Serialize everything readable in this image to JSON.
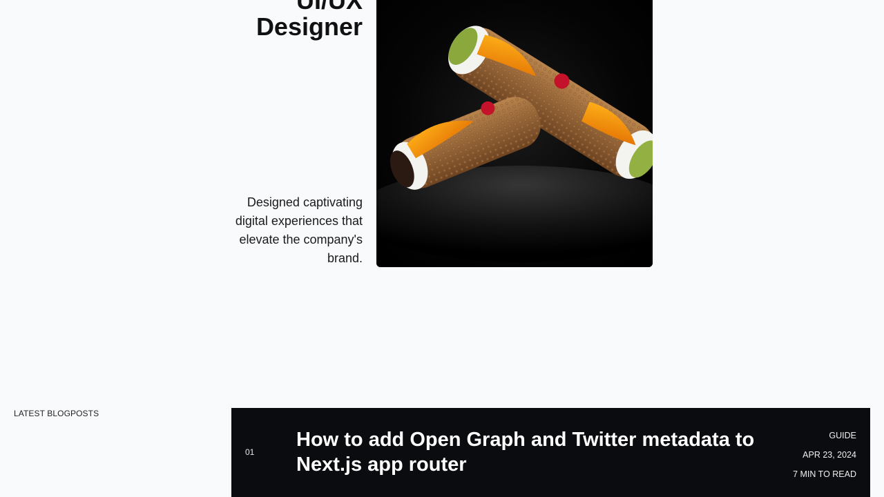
{
  "project": {
    "title_line1": "UI/UX",
    "title_line2": "Designer",
    "description": "Designed captivating digital experiences that elevate the company's brand.",
    "image_subject": "cannoli-photo"
  },
  "blog": {
    "section_label": "LATEST BLOGPOSTS",
    "posts": [
      {
        "index": "01",
        "title": "How to add Open Graph and Twitter metadata to Next.js app router",
        "category": "GUIDE",
        "date": "APR 23, 2024",
        "read_time": "7 MIN TO READ"
      }
    ]
  },
  "colors": {
    "page_background": "#f8fafc",
    "card_background": "#0b0c0f",
    "text_dark": "#111111",
    "text_light": "#ffffff"
  }
}
